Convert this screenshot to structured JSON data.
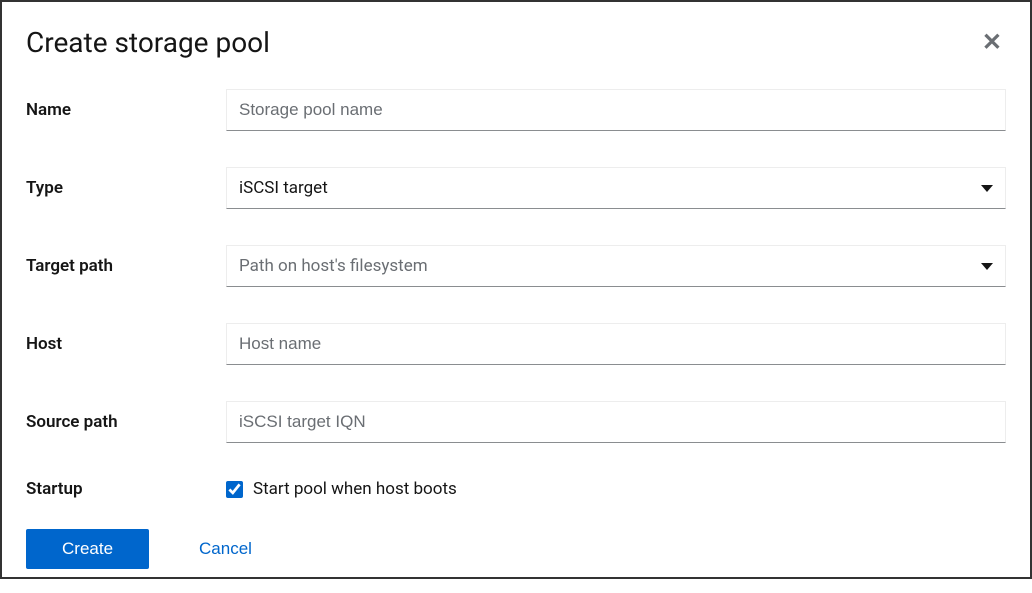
{
  "dialog": {
    "title": "Create storage pool"
  },
  "fields": {
    "name": {
      "label": "Name",
      "placeholder": "Storage pool name",
      "value": ""
    },
    "type": {
      "label": "Type",
      "value": "iSCSI target"
    },
    "target_path": {
      "label": "Target path",
      "placeholder": "Path on host's filesystem",
      "value": ""
    },
    "host": {
      "label": "Host",
      "placeholder": "Host name",
      "value": ""
    },
    "source_path": {
      "label": "Source path",
      "placeholder": "iSCSI target IQN",
      "value": ""
    },
    "startup": {
      "label": "Startup",
      "checkbox_label": "Start pool when host boots",
      "checked": true
    }
  },
  "actions": {
    "create": "Create",
    "cancel": "Cancel"
  }
}
